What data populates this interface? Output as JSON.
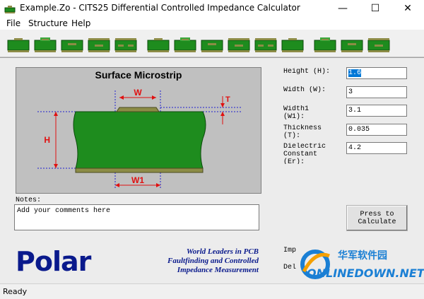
{
  "window": {
    "title": "Example.Zo - CITS25 Differential Controlled Impedance Calculator",
    "minimize": "—",
    "maximize": "☐",
    "close": "✕"
  },
  "menu": [
    "File",
    "Structure",
    "Help"
  ],
  "toolbar": {
    "structure_buttons": [
      "surface-microstrip",
      "coated-microstrip",
      "embedded-microstrip",
      "offset-stripline-1",
      "offset-stripline-2",
      "edge-coupled-surface",
      "edge-coupled-coated",
      "edge-coupled-embedded",
      "edge-coupled-stripline",
      "edge-coupled-offset",
      "broadside-coupled-1",
      "broadside-coupled-2",
      "broadside-coupled-3",
      "broadside-coupled-4"
    ]
  },
  "diagram": {
    "title": "Surface Microstrip",
    "labels": {
      "w": "W",
      "t": "T",
      "h": "H",
      "w1": "W1"
    },
    "colors": {
      "dielectric": "#1e8c1e",
      "trace": "#8c8c46",
      "dimension": "#e01010",
      "guide": "#2020d0"
    }
  },
  "fields": [
    {
      "label": "Height (H):",
      "value": "1.6",
      "selected": true
    },
    {
      "label": "Width (W):",
      "value": "3"
    },
    {
      "label": "Width1 (W1):",
      "value": "3.1"
    },
    {
      "label": "Thickness (T):",
      "value": "0.035"
    },
    {
      "label": "Dielectric Constant (Er):",
      "value": "4.2"
    }
  ],
  "notes": {
    "label": "Notes:",
    "text": "Add your comments here"
  },
  "calculate": {
    "line1": "Press to",
    "line2": "Calculate"
  },
  "results": {
    "impedance_label": "Imp",
    "delay_label": "Del"
  },
  "logo": {
    "text": "Polar"
  },
  "tagline": [
    "World Leaders in PCB",
    "Faultfinding and Controlled",
    "Impedance Measurement"
  ],
  "status": "Ready",
  "watermark": {
    "text": "ONLINEDOWN.NET",
    "cn": "华军软件园"
  }
}
